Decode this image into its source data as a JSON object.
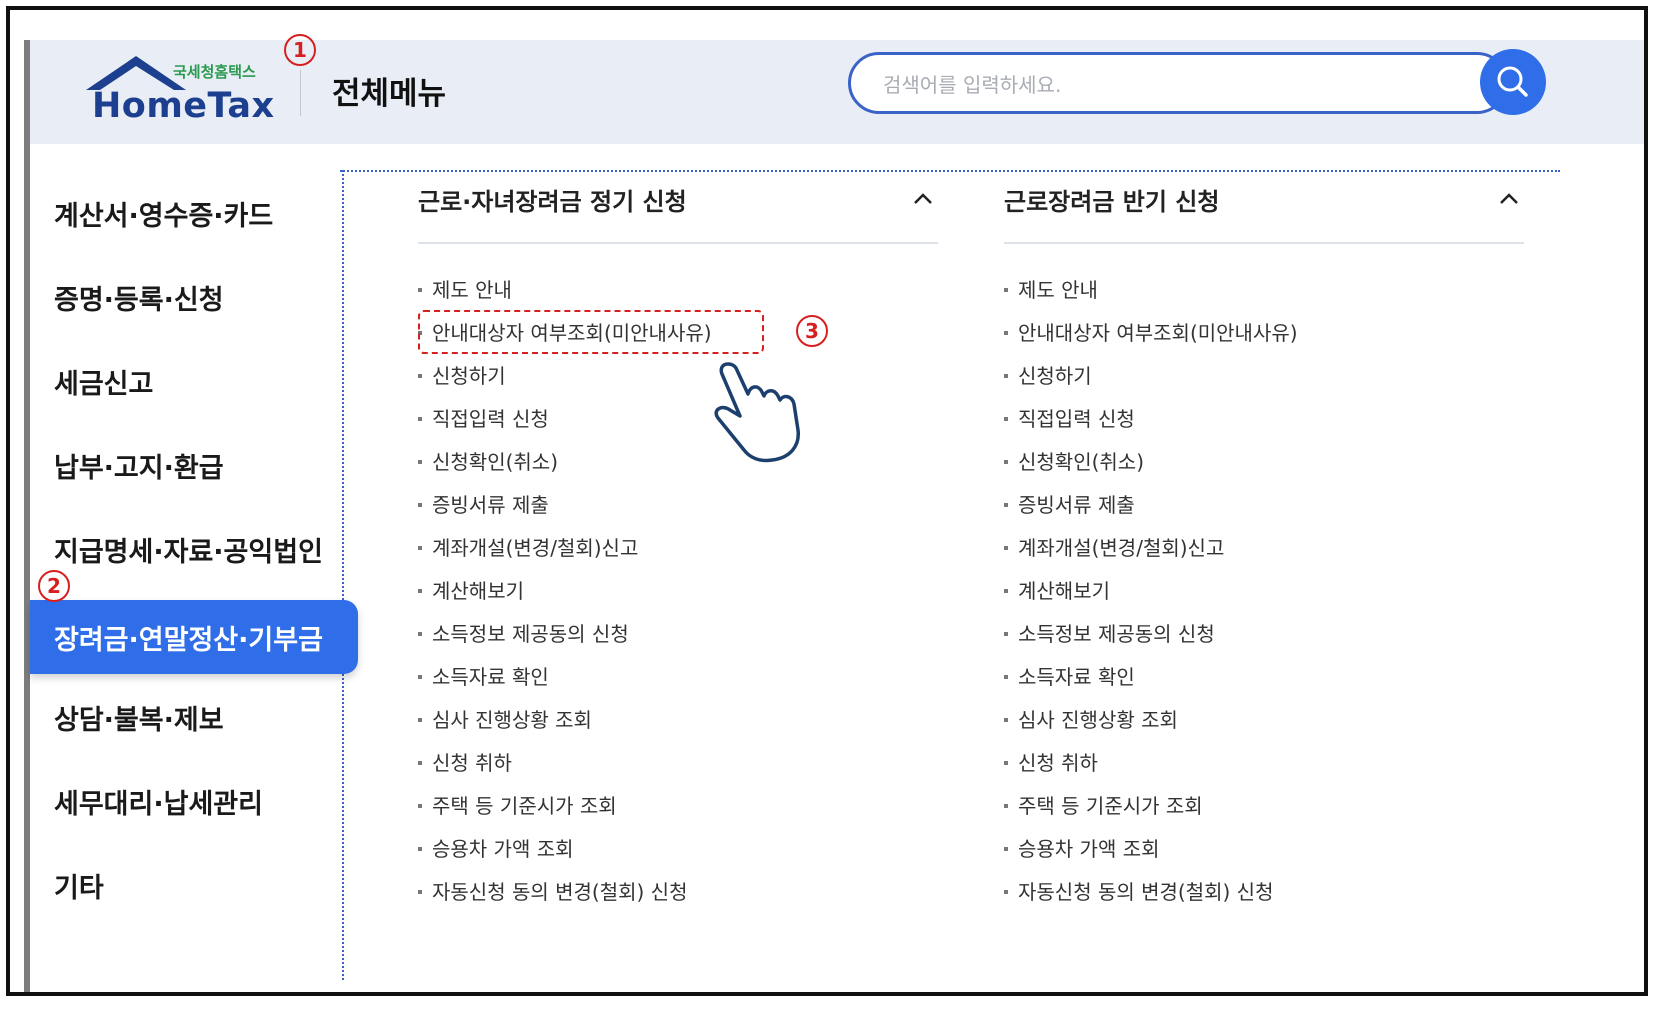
{
  "header": {
    "logo_top": "국세청홈택스",
    "logo_main": "HomeTax",
    "menu_title": "전체메뉴",
    "search_placeholder": "검색어를 입력하세요."
  },
  "sidebar": {
    "items": [
      {
        "label": "계산서·영수증·카드"
      },
      {
        "label": "증명·등록·신청"
      },
      {
        "label": "세금신고"
      },
      {
        "label": "납부·고지·환급"
      },
      {
        "label": "지급명세·자료·공익법인"
      },
      {
        "label": "장려금·연말정산·기부금",
        "active": true
      },
      {
        "label": "상담·불복·제보"
      },
      {
        "label": "세무대리·납세관리"
      },
      {
        "label": "기타"
      }
    ]
  },
  "columns": [
    {
      "title": "근로·자녀장려금 정기 신청",
      "items": [
        "제도 안내",
        "안내대상자 여부조회(미안내사유)",
        "신청하기",
        "직접입력 신청",
        "신청확인(취소)",
        "증빙서류 제출",
        "계좌개설(변경/철회)신고",
        "계산해보기",
        "소득정보 제공동의 신청",
        "소득자료 확인",
        "심사 진행상황 조회",
        "신청 취하",
        "주택 등 기준시가 조회",
        "승용차 가액 조회",
        "자동신청 동의 변경(철회) 신청"
      ]
    },
    {
      "title": "근로장려금 반기 신청",
      "items": [
        "제도 안내",
        "안내대상자 여부조회(미안내사유)",
        "신청하기",
        "직접입력 신청",
        "신청확인(취소)",
        "증빙서류 제출",
        "계좌개설(변경/철회)신고",
        "계산해보기",
        "소득정보 제공동의 신청",
        "소득자료 확인",
        "심사 진행상황 조회",
        "신청 취하",
        "주택 등 기준시가 조회",
        "승용차 가액 조회",
        "자동신청 동의 변경(철회) 신청"
      ]
    }
  ],
  "annotations": {
    "step1": "1",
    "step2": "2",
    "step3": "3",
    "color": "#d61f1f"
  },
  "colors": {
    "accent": "#2f6ee8",
    "header_bg": "#e9eef6",
    "logo_blue": "#1d3f8f",
    "logo_green": "#2b9a4e"
  },
  "icons": {
    "search": "search-icon",
    "collapse": "chevron-up-icon",
    "pointer": "hand-pointer-icon"
  }
}
